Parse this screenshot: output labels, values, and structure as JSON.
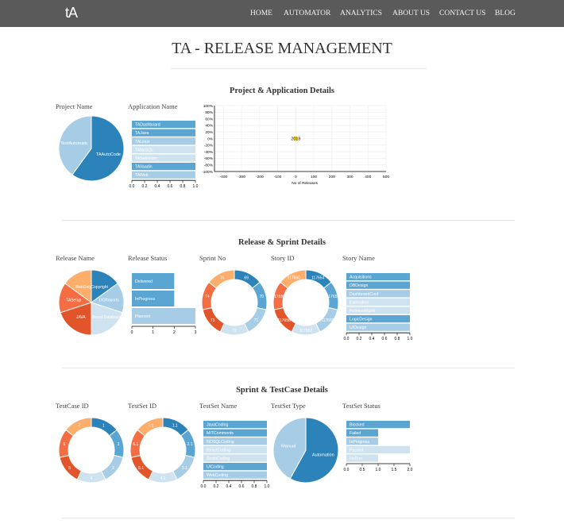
{
  "nav": {
    "logo": "tA",
    "items": [
      "HOME",
      "AUTOMATOR",
      "ANALYTICS",
      "ABOUT US",
      "CONTACT US",
      "BLOG"
    ]
  },
  "page": {
    "title": "TA - RELEASE MANAGEMENT"
  },
  "colors": {
    "navbar": "#5a5a5a",
    "blue_dark": "#2b83ba",
    "blue_mid": "#5ba5d2",
    "blue_light": "#a6cde5",
    "blue_pale": "#cfe2f0",
    "orange_light": "#fdae6b",
    "orange": "#f46d43",
    "red_orange": "#e2552b"
  },
  "sections": [
    {
      "title": "Project & Application Details",
      "labels": [
        "Project Name",
        "Application Name"
      ]
    },
    {
      "title": "Release & Sprint Details",
      "labels": [
        "Release Name",
        "Release Status",
        "Sprint No",
        "Story ID",
        "Story Name"
      ]
    },
    {
      "title": "Sprint & TestCase Details",
      "labels": [
        "TestCase ID",
        "TestSet ID",
        "TestSet Name",
        "TestSet Type",
        "TestSet Status"
      ]
    }
  ],
  "chart_data": [
    {
      "id": "project-pie",
      "type": "pie",
      "labels": [
        "TAAutoCode",
        "TestAutomatic"
      ],
      "values": [
        60,
        40
      ]
    },
    {
      "id": "application-bars",
      "type": "bar",
      "orientation": "horizontal",
      "categories": [
        "TADashboard",
        "TAJava",
        "TALinux",
        "TANoSQL",
        "TASelenium",
        "TAVaadin",
        "TAWeb"
      ],
      "values": [
        1,
        1,
        1,
        1,
        1,
        1,
        1
      ],
      "xticks": [
        "0.0",
        "0.2",
        "0.4",
        "0.6",
        "0.8",
        "1.0"
      ],
      "xlim": [
        0,
        1
      ]
    },
    {
      "id": "release-scatter",
      "type": "scatter",
      "points": [
        {
          "x": 0,
          "y": 0,
          "label": "2018"
        }
      ],
      "xlabel": "No of Releases",
      "xticks": [
        "-400",
        "-300",
        "-200",
        "-100",
        "0",
        "100",
        "200",
        "300",
        "400",
        "500"
      ],
      "yticks": [
        "100%",
        "80%",
        "60%",
        "40%",
        "20%",
        "0%",
        "-20%",
        "-40%",
        "-60%",
        "-80%",
        "-100%"
      ],
      "xlim": [
        -450,
        500
      ],
      "ylim": [
        -100,
        100
      ],
      "grid": true
    },
    {
      "id": "release-name-pie",
      "type": "pie",
      "labels": [
        "Copyright",
        "DCReports",
        "DashBoard Database",
        "JAVA",
        "TASetup",
        "WebOnly"
      ],
      "values": [
        15,
        15,
        20,
        20,
        15,
        15
      ]
    },
    {
      "id": "release-status-bars",
      "type": "bar",
      "orientation": "horizontal",
      "categories": [
        "Delivered",
        "InProgress",
        "Planned"
      ],
      "values": [
        2,
        2,
        3
      ],
      "xticks": [
        "0",
        "1",
        "2",
        "3"
      ],
      "xlim": [
        0,
        3
      ]
    },
    {
      "id": "sprint-no-donut",
      "type": "pie",
      "labels": [
        "69",
        "70",
        "71",
        "72",
        "73",
        "74",
        "75"
      ],
      "values": [
        1,
        1,
        1,
        1,
        1,
        1,
        1
      ]
    },
    {
      "id": "story-id-donut",
      "type": "pie",
      "labels": [
        "117654",
        "117655",
        "117656",
        "117657",
        "117658",
        "117659",
        "117660"
      ],
      "values": [
        1,
        1,
        1,
        1,
        1,
        1,
        1
      ]
    },
    {
      "id": "story-name-bars",
      "type": "bar",
      "orientation": "horizontal",
      "categories": [
        "Acquisitions",
        "DBDesign",
        "DashboardConf",
        "Estimation",
        "ReleaseMgmt",
        "LogicDesign",
        "UIDesign"
      ],
      "values": [
        1,
        1,
        1,
        1,
        1,
        1,
        1
      ],
      "xticks": [
        "0.0",
        "0.2",
        "0.4",
        "0.6",
        "0.8",
        "1.0"
      ],
      "xlim": [
        0,
        1
      ]
    },
    {
      "id": "testcase-id-donut",
      "type": "pie",
      "labels": [
        "1",
        "2",
        "3",
        "4",
        "5",
        "6",
        "7"
      ],
      "values": [
        1,
        1,
        1,
        1,
        1,
        1,
        1
      ]
    },
    {
      "id": "testset-id-donut",
      "type": "pie",
      "labels": [
        "1.1",
        "2.1",
        "3.1",
        "4.1",
        "5.1",
        "6.1",
        "7.1"
      ],
      "values": [
        1,
        1,
        1,
        1,
        1,
        1,
        1
      ]
    },
    {
      "id": "testset-name-bars",
      "type": "bar",
      "orientation": "horizontal",
      "categories": [
        "JavaCoding",
        "MITComments",
        "NOSQLCoding",
        "ReactCoding",
        "ScalaCoding",
        "UICoding",
        "WebCoding"
      ],
      "values": [
        1,
        1,
        1,
        1,
        1,
        1,
        1
      ],
      "xticks": [
        "0.0",
        "0.2",
        "0.4",
        "0.6",
        "0.8",
        "1.0"
      ],
      "xlim": [
        0,
        1
      ]
    },
    {
      "id": "testset-type-pie",
      "type": "pie",
      "labels": [
        "Automation",
        "Manual"
      ],
      "values": [
        58,
        42
      ]
    },
    {
      "id": "testset-status-bars",
      "type": "bar",
      "orientation": "horizontal",
      "categories": [
        "Blocked",
        "Failed",
        "InProgress",
        "Passed",
        "NoRun"
      ],
      "values": [
        2,
        1,
        1,
        2,
        1
      ],
      "xticks": [
        "0.0",
        "0.5",
        "1.0",
        "1.5",
        "2.0"
      ],
      "xlim": [
        0,
        2
      ]
    }
  ]
}
